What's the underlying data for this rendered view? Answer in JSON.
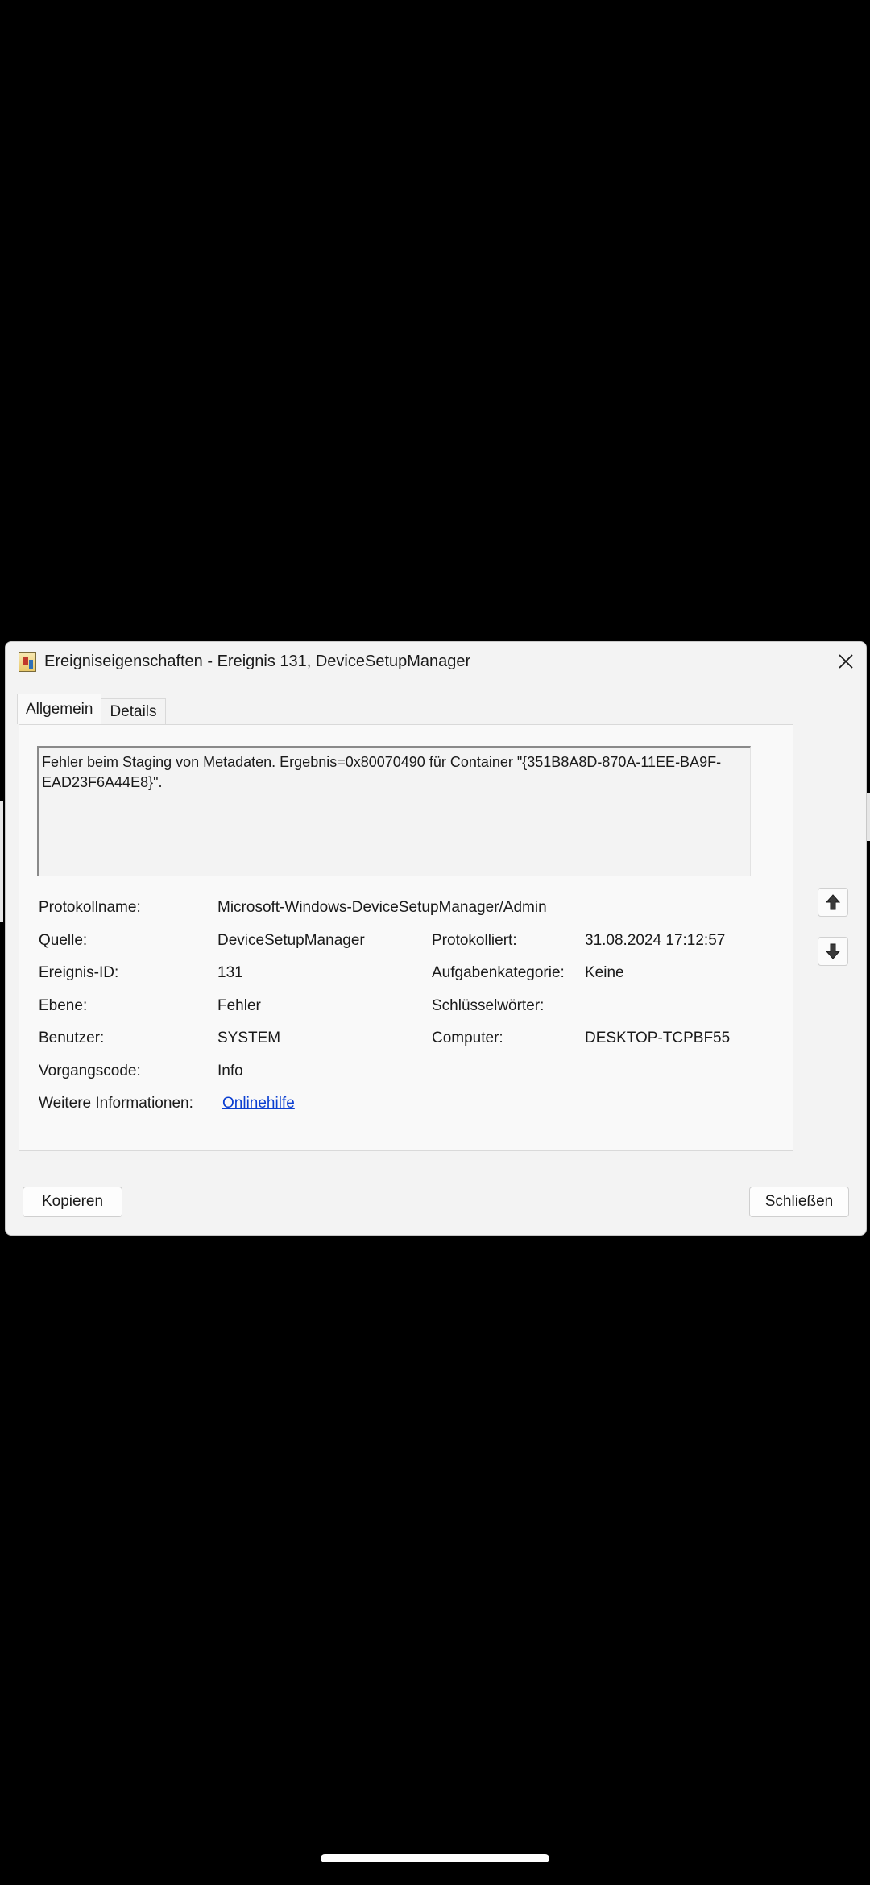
{
  "dialog": {
    "title": "Ereigniseigenschaften - Ereignis 131, DeviceSetupManager",
    "app_icon": "event-viewer-icon",
    "close_icon": "close-icon"
  },
  "tabs": [
    {
      "label": "Allgemein",
      "active": true
    },
    {
      "label": "Details",
      "active": false
    }
  ],
  "message": "Fehler beim Staging von Metadaten. Ergebnis=0x80070490 für Container \"{351B8A8D-870A-11EE-BA9F-EAD23F6A44E8}\".",
  "fields": {
    "protokollname": {
      "label": "Protokollname:",
      "value": "Microsoft-Windows-DeviceSetupManager/Admin"
    },
    "quelle": {
      "label": "Quelle:",
      "value": "DeviceSetupManager"
    },
    "protokolliert": {
      "label": "Protokolliert:",
      "value": "31.08.2024 17:12:57"
    },
    "ereignis_id": {
      "label": "Ereignis-ID:",
      "value": "131"
    },
    "aufgabenkategorie": {
      "label": "Aufgabenkategorie:",
      "value": "Keine"
    },
    "ebene": {
      "label": "Ebene:",
      "value": "Fehler"
    },
    "schluesselwoerter": {
      "label": "Schlüsselwörter:",
      "value": ""
    },
    "benutzer": {
      "label": "Benutzer:",
      "value": "SYSTEM"
    },
    "computer": {
      "label": "Computer:",
      "value": "DESKTOP-TCPBF55"
    },
    "vorgangscode": {
      "label": "Vorgangscode:",
      "value": "Info"
    },
    "weitere_info": {
      "label": "Weitere Informationen:",
      "value": "Onlinehilfe"
    }
  },
  "nav": {
    "up_icon": "arrow-up-icon",
    "down_icon": "arrow-down-icon"
  },
  "buttons": {
    "copy": "Kopieren",
    "close": "Schließen"
  },
  "colors": {
    "background": "#000000",
    "dialog": "#f3f3f3",
    "link": "#0b3fd1"
  }
}
